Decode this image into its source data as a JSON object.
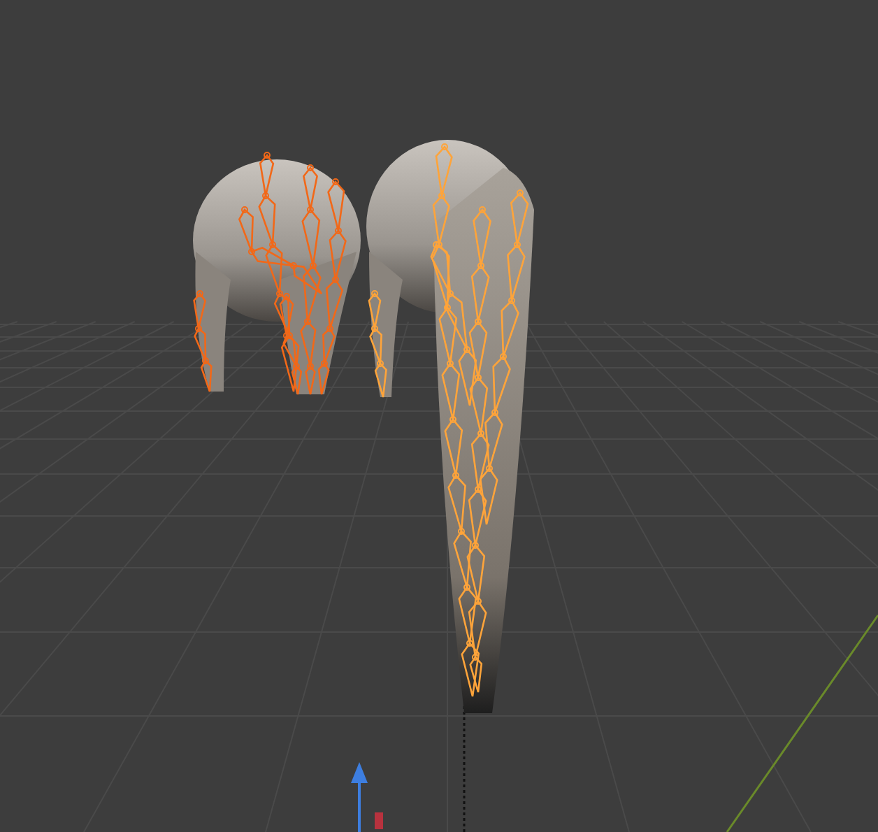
{
  "viewport": {
    "armatures": [
      {
        "active": false
      },
      {
        "active": true
      }
    ]
  }
}
